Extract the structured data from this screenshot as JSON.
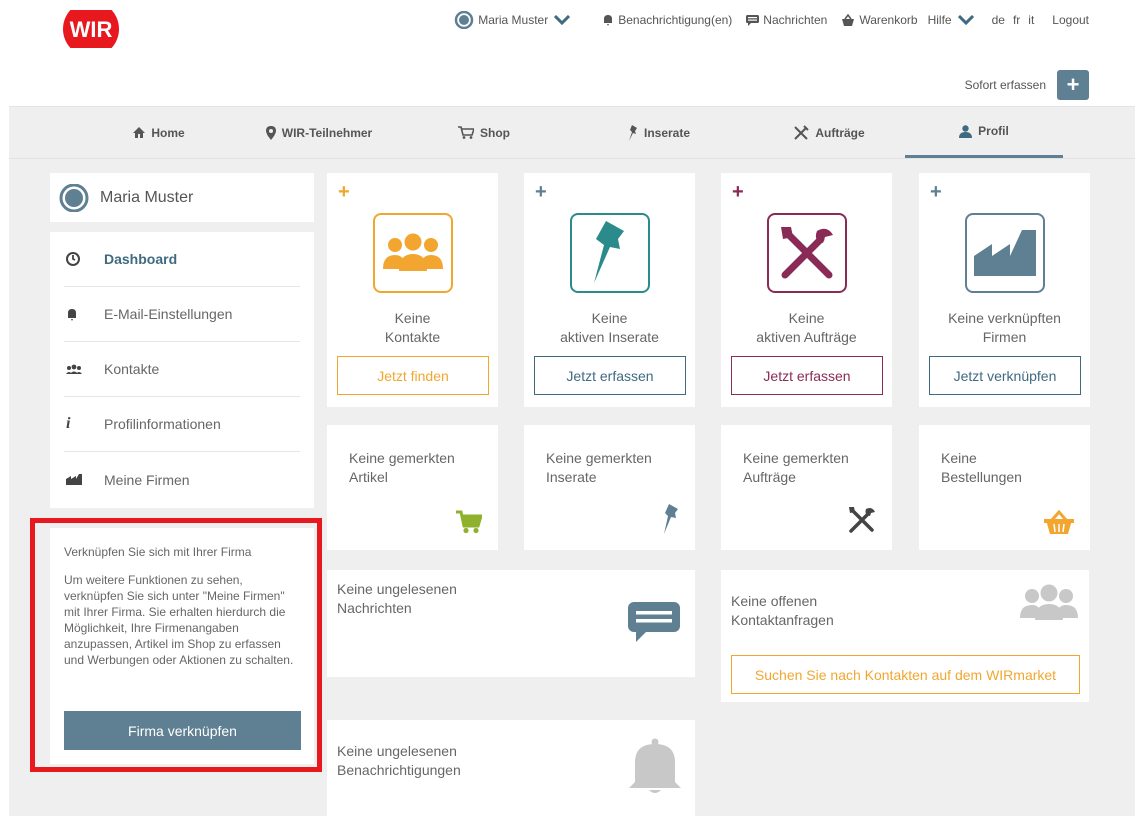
{
  "header": {
    "user_name": "Maria Muster",
    "notifications": "Benachrichtigung(en)",
    "messages": "Nachrichten",
    "cart": "Warenkorb",
    "help": "Hilfe",
    "lang_de": "de",
    "lang_fr": "fr",
    "lang_it": "it",
    "logout": "Logout",
    "quick_add": "Sofort erfassen",
    "quick_add_icon": "+"
  },
  "nav": {
    "home": "Home",
    "participants": "WIR-Teilnehmer",
    "shop": "Shop",
    "ads": "Inserate",
    "orders": "Aufträge",
    "profile": "Profil"
  },
  "sidebar": {
    "user_name": "Maria Muster",
    "items": [
      {
        "label": "Dashboard"
      },
      {
        "label": "E-Mail-Einstellungen"
      },
      {
        "label": "Kontakte"
      },
      {
        "label": "Profilinformationen"
      },
      {
        "label": "Meine Firmen"
      }
    ],
    "info_title": "Verknüpfen Sie sich mit Ihrer Firma",
    "info_text": "Um weitere Funktionen zu sehen, verknüpfen Sie sich unter \"Meine Firmen\" mit Ihrer Firma. Sie erhalten hierdurch die Möglichkeit, Ihre Firmenangaben anzupassen, Artikel im Shop zu erfassen und Werbungen oder Aktionen zu schalten.",
    "info_button": "Firma verknüpfen"
  },
  "tiles": [
    {
      "plus": "+",
      "line1": "Keine",
      "line2": "Kontakte",
      "button": "Jetzt finden",
      "color": "#f2a630"
    },
    {
      "plus": "+",
      "line1": "Keine",
      "line2": "aktiven Inserate",
      "button": "Jetzt erfassen",
      "color": "#2b8a8c"
    },
    {
      "plus": "+",
      "line1": "Keine",
      "line2": "aktiven Aufträge",
      "button": "Jetzt erfassen",
      "color": "#8a2b57"
    },
    {
      "plus": "+",
      "line1": "Keine verknüpften",
      "line2": "Firmen",
      "button": "Jetzt verknüpfen",
      "color": "#5e8092"
    }
  ],
  "small_tiles": [
    {
      "line1": "Keine gemerkten",
      "line2": "Artikel",
      "icon_color": "#8fb22e"
    },
    {
      "line1": "Keine gemerkten",
      "line2": "Inserate",
      "icon_color": "#5e8092"
    },
    {
      "line1": "Keine gemerkten",
      "line2": "Aufträge",
      "icon_color": "#444444"
    },
    {
      "line1": "Keine",
      "line2": "Bestellungen",
      "icon_color": "#f2a630"
    }
  ],
  "messages_tile": {
    "line1": "Keine ungelesenen",
    "line2": "Nachrichten",
    "icon_color": "#5e8092"
  },
  "contacts_tile": {
    "line1": "Keine offenen",
    "line2": "Kontaktanfragen",
    "button": "Suchen Sie nach Kontakten auf dem WIRmarket"
  },
  "notifications_tile": {
    "line1": "Keine ungelesenen",
    "line2": "Benachrichtigungen"
  },
  "colors": {
    "accent": "#5e8092",
    "logo": "#e8191e",
    "highlight": "#e8191e"
  }
}
